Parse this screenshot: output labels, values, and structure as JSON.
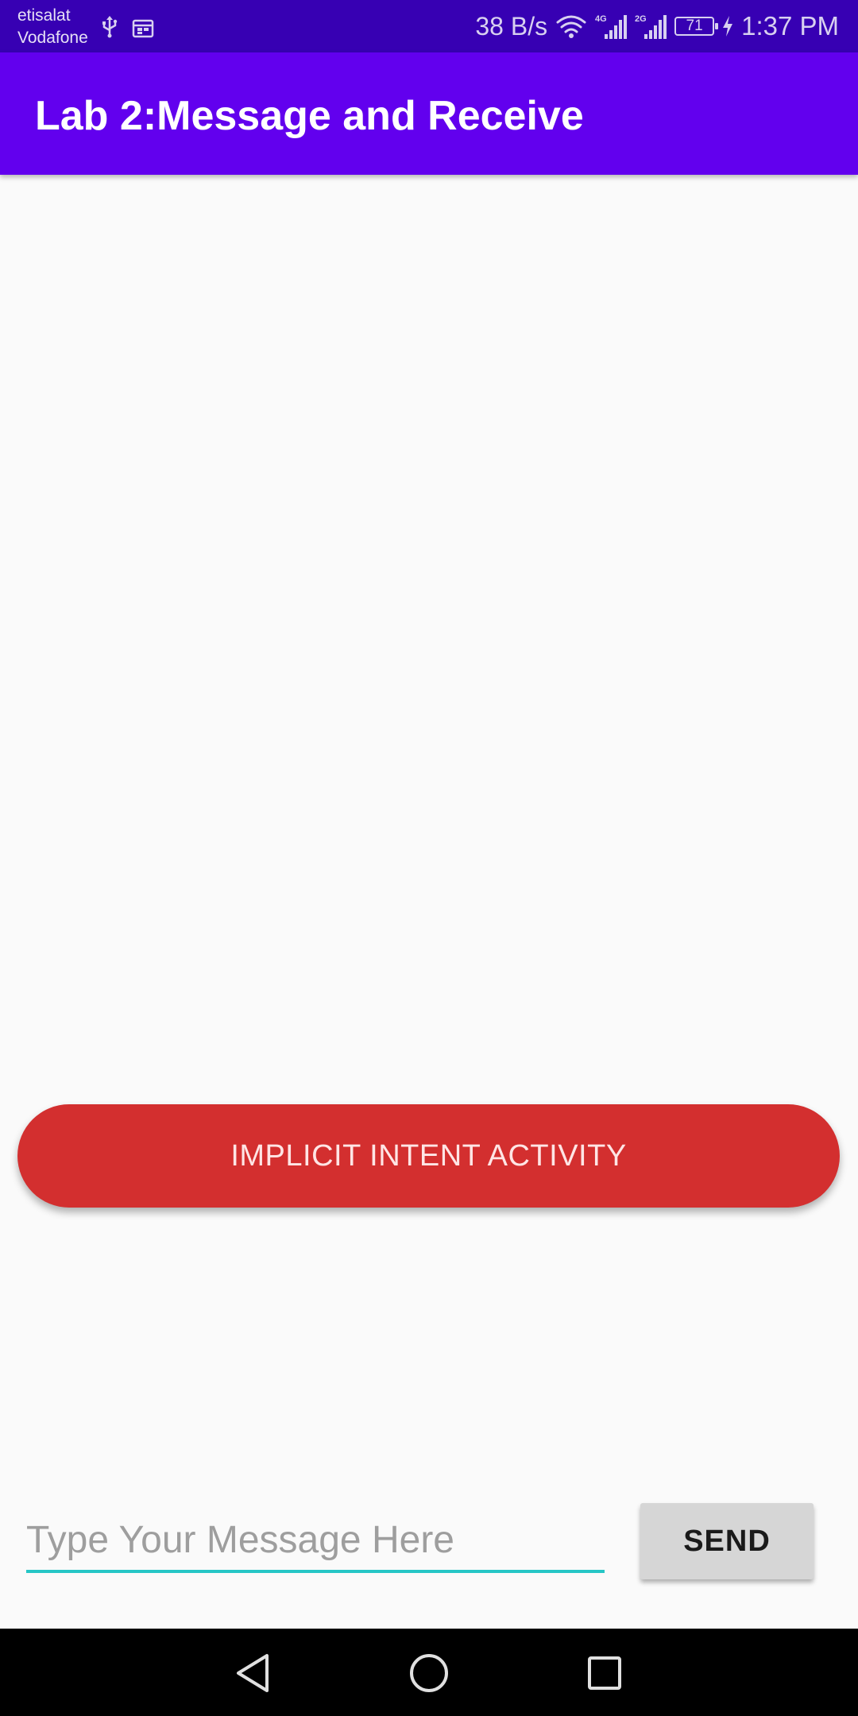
{
  "status_bar": {
    "carrier_1": "etisalat",
    "carrier_2": "Vodafone",
    "icons_left": [
      "usb-icon",
      "calendar-icon"
    ],
    "net_speed": "38 B/s",
    "icons_right": [
      "wifi-icon",
      "signal-4g-icon",
      "signal-2g-icon",
      "battery-icon",
      "charging-icon"
    ],
    "network_1": "4G",
    "network_2": "2G",
    "battery_level": "71",
    "time": "1:37 PM",
    "colors": {
      "background": "#3700b3"
    }
  },
  "app_bar": {
    "title": "Lab 2:Message and Receive",
    "colors": {
      "background": "#6200ee",
      "text": "#ffffff"
    }
  },
  "main": {
    "intent_button_label": "IMPLICIT INTENT ACTIVITY",
    "intent_button_color": "#d32f2f",
    "message_input": {
      "placeholder": "Type Your Message Here",
      "value": "",
      "underline_color": "#26c6c6"
    },
    "send_button_label": "SEND"
  },
  "nav_bar": {
    "buttons": [
      "back-icon",
      "home-icon",
      "recent-apps-icon"
    ]
  }
}
